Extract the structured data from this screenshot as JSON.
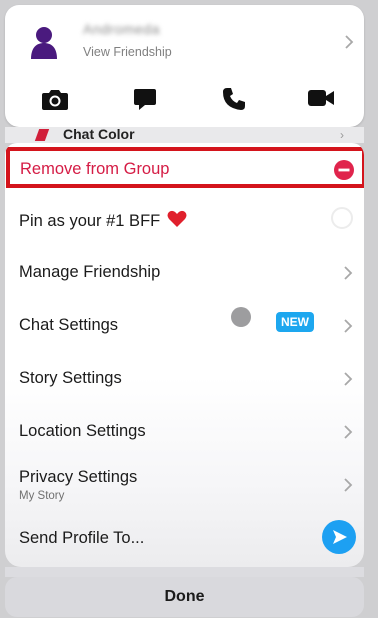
{
  "profile": {
    "name": "Andromeda",
    "view_friendship_label": "View Friendship",
    "avatar_color": "#4a1a7e"
  },
  "actions": [
    {
      "icon": "camera-icon"
    },
    {
      "icon": "chat-icon"
    },
    {
      "icon": "phone-icon"
    },
    {
      "icon": "video-icon"
    }
  ],
  "behind_row": {
    "label": "Chat Color"
  },
  "menu": {
    "remove_from_group": "Remove from Group",
    "pin_bff": "Pin as your #1 BFF",
    "manage_friendship": "Manage Friendship",
    "chat_settings": "Chat Settings",
    "chat_settings_badge": "NEW",
    "story_settings": "Story Settings",
    "location_settings": "Location Settings",
    "privacy_settings": "Privacy Settings",
    "privacy_settings_sub": "My Story",
    "send_profile_to": "Send Profile To..."
  },
  "done_label": "Done",
  "colors": {
    "remove_text": "#d51c45",
    "highlight_border": "#d4141c",
    "new_badge": "#1da7ef",
    "send_button": "#1da0f2"
  }
}
